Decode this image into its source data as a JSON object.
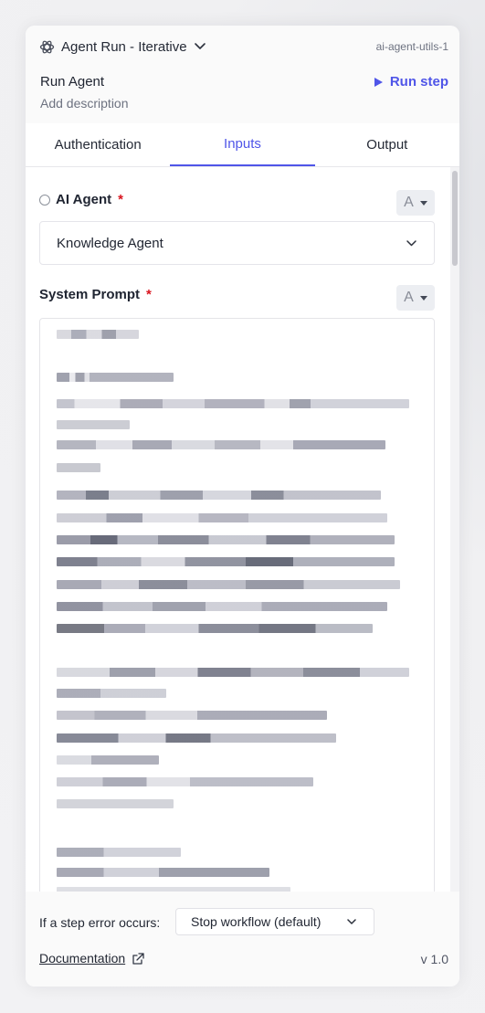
{
  "header": {
    "title": "Agent Run - Iterative",
    "utils": "ai-agent-utils-1",
    "run_agent": "Run Agent",
    "description": "Add description",
    "run_step": "Run step",
    "accent_color": "#4f55e8"
  },
  "tabs": [
    {
      "label": "Authentication",
      "active": false
    },
    {
      "label": "Inputs",
      "active": true
    },
    {
      "label": "Output",
      "active": false
    }
  ],
  "inputs": {
    "ai_agent": {
      "label": "AI Agent",
      "required_mark": "*",
      "value": "Knowledge Agent",
      "type_label": "A"
    },
    "system_prompt": {
      "label": "System Prompt",
      "required_mark": "*",
      "type_label": "A"
    }
  },
  "footer": {
    "error_label": "If a step error occurs:",
    "workflow_value": "Stop workflow (default)",
    "documentation": "Documentation",
    "version": "v 1.0"
  },
  "icons": {
    "agent": "atom-icon",
    "dropdown": "chevron-down-icon",
    "run": "play-icon",
    "external": "external-link-icon"
  }
}
